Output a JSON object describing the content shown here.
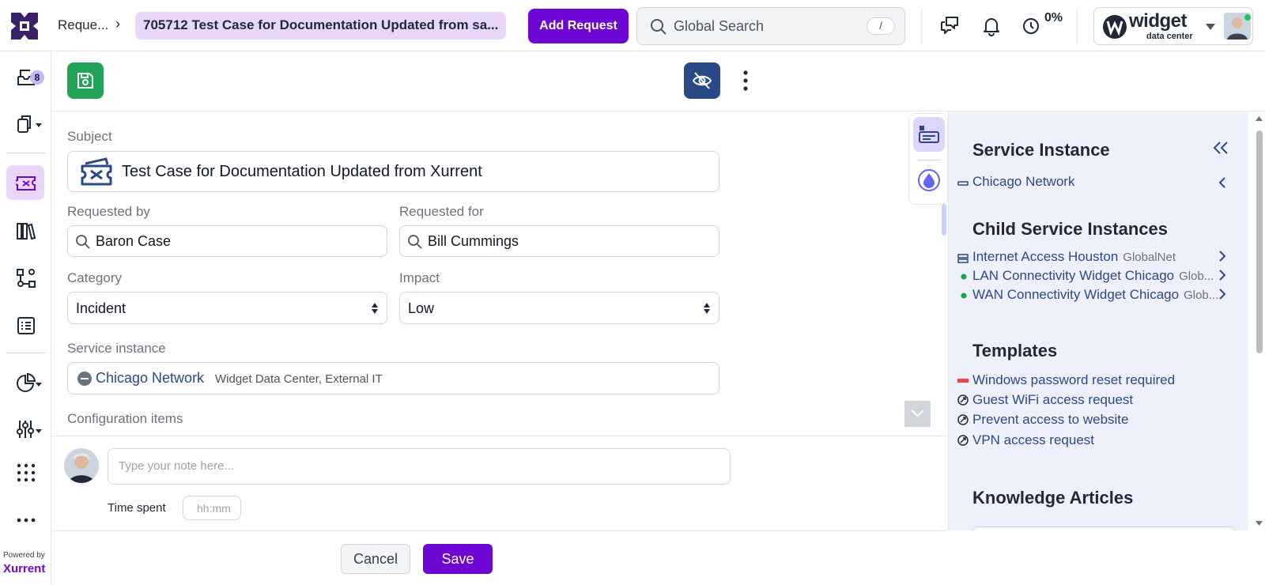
{
  "header": {
    "breadcrumb_root": "Reque...",
    "breadcrumb_current": "705712  Test Case for Documentation Updated from sa...",
    "add_request_label": "Add Request",
    "search_placeholder": "Global Search",
    "search_shortcut": "/",
    "progress_percent": "0%",
    "account_brand": "widget",
    "account_brand_sub": "data center"
  },
  "sidebar": {
    "inbox_badge": "8",
    "powered_by": "Powered by",
    "brand": "Xurrent"
  },
  "form": {
    "subject_label": "Subject",
    "subject_value": "Test Case for Documentation Updated from Xurrent",
    "requested_by_label": "Requested by",
    "requested_by_value": "Baron Case",
    "requested_for_label": "Requested for",
    "requested_for_value": "Bill Cummings",
    "category_label": "Category",
    "category_value": "Incident",
    "impact_label": "Impact",
    "impact_value": "Low",
    "service_instance_label": "Service instance",
    "service_instance_value": "Chicago Network",
    "service_instance_sub": "Widget Data Center, External IT",
    "configuration_items_label": "Configuration items"
  },
  "note": {
    "placeholder": "Type your note here...",
    "time_spent_label": "Time spent",
    "time_placeholder": "hh:mm"
  },
  "footer": {
    "cancel_label": "Cancel",
    "save_label": "Save"
  },
  "panel": {
    "service_instance_heading": "Service Instance",
    "service_instance_item": "Chicago Network",
    "child_heading": "Child Service Instances",
    "children": [
      {
        "name": "Internet Access Houston",
        "sub": "GlobalNet"
      },
      {
        "name": "LAN Connectivity Widget Chicago",
        "sub": "Glob..."
      },
      {
        "name": "WAN Connectivity Widget Chicago",
        "sub": "Glob..."
      }
    ],
    "templates_heading": "Templates",
    "templates": [
      "Windows password reset required",
      "Guest WiFi access request",
      "Prevent access to website",
      "VPN access request"
    ],
    "knowledge_heading": "Knowledge Articles"
  },
  "colors": {
    "brand_purple": "#6f07d4",
    "save_green": "#22a35a",
    "hide_blue": "#2a4a87",
    "panel_bg": "#eef0fb",
    "status_green": "#16a34a",
    "template_red": "#ef4444"
  },
  "icons": [
    "xurrent-logo-icon",
    "chevron-right-icon",
    "search-icon",
    "feedback-icon",
    "bell-icon",
    "timer-icon",
    "caret-down-icon",
    "inbox-icon",
    "documents-icon",
    "ticket-icon",
    "library-icon",
    "workflow-icon",
    "list-icon",
    "pie-chart-icon",
    "settings-sliders-icon",
    "apps-grid-icon",
    "more-horizontal-icon",
    "save-icon",
    "eye-off-icon",
    "more-vertical-icon",
    "details-card-icon",
    "ai-drop-icon",
    "double-chevron-left-icon",
    "chevron-left-icon",
    "server-icon",
    "status-dot-icon",
    "template-icon"
  ]
}
